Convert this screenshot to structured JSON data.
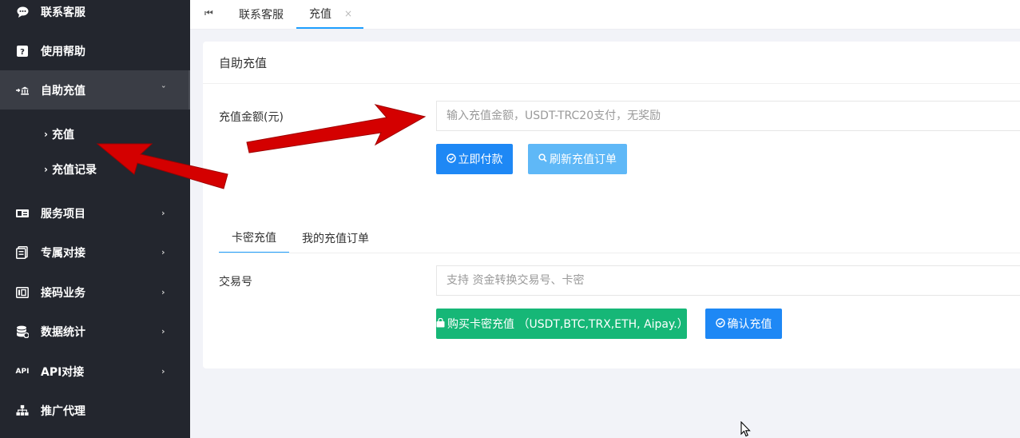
{
  "sidebar": {
    "items": [
      {
        "label": "联系客服",
        "icon": "chat-icon"
      },
      {
        "label": "使用帮助",
        "icon": "help-icon"
      },
      {
        "label": "自助充值",
        "icon": "bank-transfer-icon"
      },
      {
        "label": "服务项目",
        "icon": "card-icon"
      },
      {
        "label": "专属对接",
        "icon": "document-icon"
      },
      {
        "label": "接码业务",
        "icon": "code-icon"
      },
      {
        "label": "数据统计",
        "icon": "database-icon"
      },
      {
        "label": "API对接",
        "icon": "api-icon"
      },
      {
        "label": "推广代理",
        "icon": "sitemap-icon"
      }
    ],
    "sub_items": [
      {
        "label": "充值"
      },
      {
        "label": "充值记录"
      }
    ],
    "api_icon_text": "API"
  },
  "tabs": {
    "home_icon": "⏮",
    "items": [
      {
        "label": "联系客服"
      },
      {
        "label": "充值",
        "close": "×"
      }
    ]
  },
  "card": {
    "title": "自助充值",
    "amount_label": "充值金额(元)",
    "amount_placeholder": "输入充值金额，USDT-TRC20支付，无奖励",
    "pay_button": "立即付款",
    "refresh_button": "刷新充值订单",
    "subtabs": [
      "卡密充值",
      "我的充值订单"
    ],
    "txn_label": "交易号",
    "txn_placeholder": "支持 资金转换交易号、卡密",
    "buy_button": "购买卡密充值 （USDT,BTC,TRX,ETH, Aipay.）",
    "confirm_button": "确认充值"
  },
  "colors": {
    "sidebar_bg": "#23262e",
    "primary": "#1e88f5",
    "light_primary": "#5fb8f7",
    "success": "#16b777",
    "annotation_arrow": "#d40000"
  }
}
